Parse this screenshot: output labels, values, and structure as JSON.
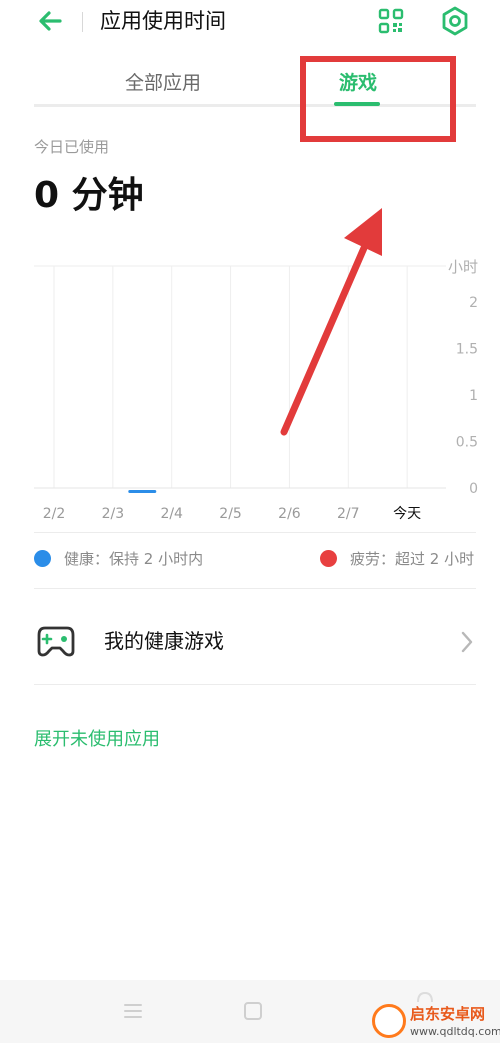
{
  "header": {
    "title": "应用使用时间",
    "back_icon": "arrow-left-icon",
    "qr_icon": "qr-code-icon",
    "settings_icon": "hexagon-gear-icon",
    "accent": "#2bbd6f"
  },
  "tabs": [
    {
      "label": "全部应用",
      "active": false
    },
    {
      "label": "游戏",
      "active": true
    }
  ],
  "usage": {
    "label": "今日已使用",
    "value": "0 分钟"
  },
  "chart_data": {
    "type": "bar",
    "categories": [
      "2/2",
      "2/3",
      "2/4",
      "2/5",
      "2/6",
      "2/7",
      "今天"
    ],
    "values": [
      0,
      0,
      0,
      0,
      0,
      0,
      0
    ],
    "ylabel": "小时",
    "yticks": [
      "2",
      "1.5",
      "1",
      "0.5",
      "0"
    ],
    "ylim": [
      0,
      2
    ],
    "grid": true,
    "bar_color": "#2b8de8",
    "highlight_category": "今天"
  },
  "legend": {
    "healthy": {
      "label": "健康：保持 2 小时内",
      "color": "#2b8de8"
    },
    "tired": {
      "label": "疲劳：超过 2 小时",
      "color": "#e84040"
    }
  },
  "health_games": {
    "label": "我的健康游戏",
    "icon": "gamepad-icon"
  },
  "expand_link": "展开未使用应用",
  "annotation": {
    "box_color": "#e23b3b",
    "arrow_color": "#e23b3b"
  },
  "watermark": {
    "title": "启东安卓网",
    "url": "www.qdltdq.com"
  }
}
